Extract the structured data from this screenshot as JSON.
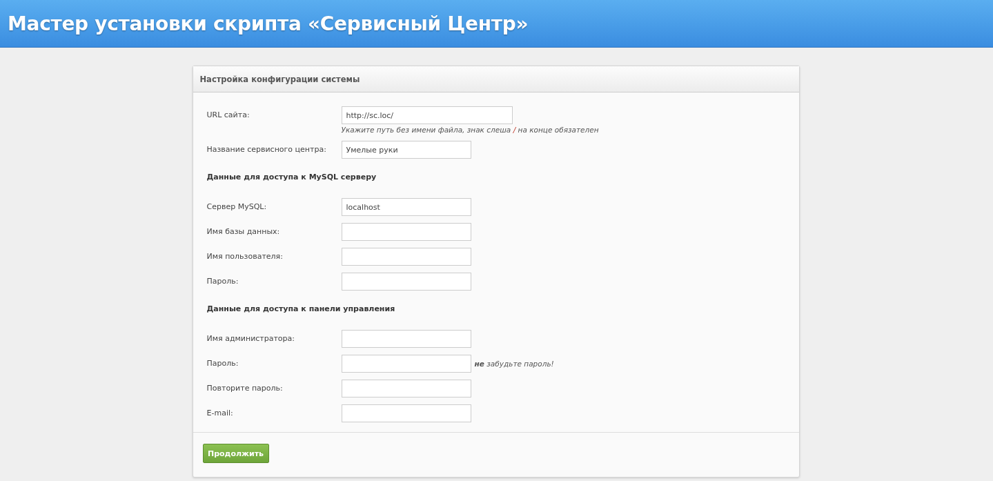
{
  "header": {
    "title": "Мастер установки скрипта «Сервисный Центр»"
  },
  "panel": {
    "title": "Настройка конфигурации системы",
    "rows": [
      {
        "kind": "field",
        "label": "URL сайта:",
        "value": "http://sc.loc/",
        "hint": [
          {
            "kind": "plain",
            "text": "Укажите путь без имени файла, знак слеша"
          },
          {
            "kind": "accent",
            "text": "/"
          },
          {
            "kind": "plain",
            "text": "на конце обязателен"
          }
        ]
      },
      {
        "kind": "field",
        "label": "Название сервисного центра:",
        "value": "Умелые руки"
      },
      {
        "kind": "heading",
        "label": "Данные для доступа к MySQL серверу"
      },
      {
        "kind": "field",
        "label": "Сервер MySQL:",
        "value": "localhost"
      },
      {
        "kind": "field",
        "label": "Имя базы данных:"
      },
      {
        "kind": "field",
        "label": "Имя пользователя:"
      },
      {
        "kind": "field",
        "label": "Пароль:"
      },
      {
        "kind": "heading",
        "label": "Данные для доступа к панели управления"
      },
      {
        "kind": "field",
        "label": "Имя администратора:"
      },
      {
        "kind": "field",
        "label": "Пароль:",
        "note": "**не** забудьте пароль!"
      },
      {
        "kind": "field",
        "label": "Повторите пароль:"
      },
      {
        "kind": "field",
        "label": "E-mail:"
      }
    ],
    "button": "Продолжить"
  }
}
